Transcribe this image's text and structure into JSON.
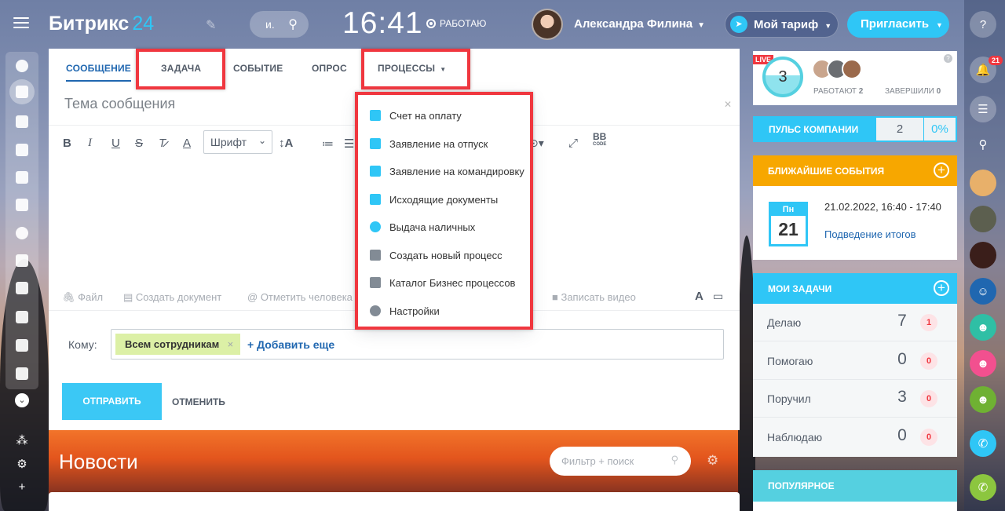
{
  "app": {
    "logo_text": "Битрикс",
    "logo_num": "24"
  },
  "topbar": {
    "search_placeholder": "и.",
    "time": "16:41",
    "work_status": "РАБОТАЮ",
    "user_name": "Александра Филина",
    "tariff_label": "Мой тариф",
    "invite_label": "Пригласить"
  },
  "composer": {
    "tabs": [
      {
        "label": "СООБЩЕНИЕ",
        "active": true
      },
      {
        "label": "ЗАДАЧА",
        "active": false
      },
      {
        "label": "СОБЫТИЕ",
        "active": false
      },
      {
        "label": "ОПРОС",
        "active": false
      },
      {
        "label": "ПРОЦЕССЫ",
        "active": false
      }
    ],
    "subject_placeholder": "Тема сообщения",
    "font_select": "Шрифт",
    "toolbar_icons": [
      "bold-icon",
      "italic-icon",
      "underline-icon",
      "strikethrough-icon",
      "clear-format-icon",
      "text-color-icon",
      "font-size-icon",
      "numbered-list-icon",
      "bullet-list-icon",
      "fullscreen-icon",
      "bbcode-icon"
    ],
    "bbcode_label": "BB",
    "bbcode_sub": "CODE",
    "attachments": {
      "file": "Файл",
      "create_doc": "Создать документ",
      "mention": "Отметить человека",
      "record_video": "Записать видео"
    },
    "to_label": "Кому:",
    "recipient": "Всем сотрудникам",
    "add_more": "+ Добавить еще",
    "send_label": "ОТПРАВИТЬ",
    "cancel_label": "ОТМЕНИТЬ"
  },
  "processes_menu": {
    "items": [
      {
        "label": "Счет на оплату",
        "icon": "invoice-icon"
      },
      {
        "label": "Заявление на отпуск",
        "icon": "vacation-form-icon"
      },
      {
        "label": "Заявление на командировку",
        "icon": "business-trip-icon"
      },
      {
        "label": "Исходящие документы",
        "icon": "outgoing-docs-icon"
      },
      {
        "label": "Выдача наличных",
        "icon": "cash-icon"
      },
      {
        "label": "Создать новый процесс",
        "icon": "new-process-icon"
      },
      {
        "label": "Каталог Бизнес процессов",
        "icon": "catalog-icon"
      },
      {
        "label": "Настройки",
        "icon": "settings-gear-icon"
      }
    ]
  },
  "news": {
    "title": "Новости",
    "filter_placeholder": "Фильтр + поиск"
  },
  "widgets": {
    "live": {
      "badge": "LIVE",
      "count": "3",
      "working_label": "РАБОТАЮТ",
      "working_count": "2",
      "done_label": "ЗАВЕРШИЛИ",
      "done_count": "0"
    },
    "pulse": {
      "title": "ПУЛЬС КОМПАНИИ",
      "value": "2",
      "percent": "0%"
    },
    "events": {
      "title": "БЛИЖАЙШИЕ СОБЫТИЯ",
      "day_short": "Пн",
      "day_num": "21",
      "date_time": "21.02.2022, 16:40 - 17:40",
      "event_name": "Подведение итогов"
    },
    "tasks": {
      "title": "МОИ ЗАДАЧИ",
      "rows": [
        {
          "label": "Делаю",
          "count": "7",
          "badge": "1"
        },
        {
          "label": "Помогаю",
          "count": "0",
          "badge": "0"
        },
        {
          "label": "Поручил",
          "count": "3",
          "badge": "0"
        },
        {
          "label": "Наблюдаю",
          "count": "0",
          "badge": "0"
        }
      ]
    },
    "popular": {
      "title": "ПОПУЛЯРНОЕ"
    }
  },
  "right_rail": {
    "notifications_badge": "21"
  },
  "colors": {
    "accent": "#2fc6f6",
    "link": "#2067b0",
    "highlight_border": "#f0373f",
    "events_header": "#f7a700",
    "recipient_chip": "#dcf0a6"
  }
}
